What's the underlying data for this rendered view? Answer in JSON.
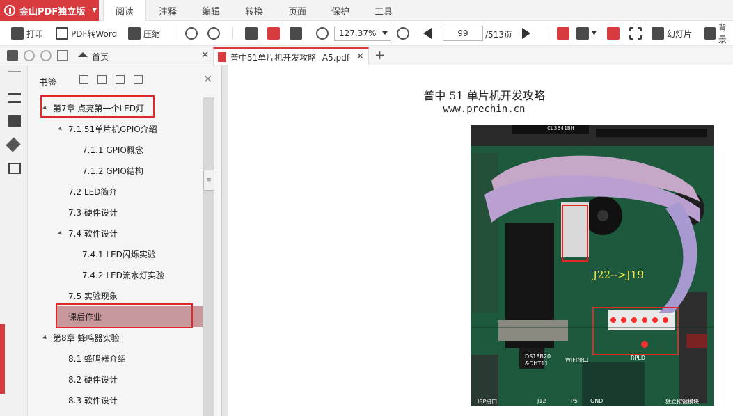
{
  "app": {
    "brand": "金山PDF独立版"
  },
  "menu": {
    "tabs": [
      "阅读",
      "注释",
      "编辑",
      "转换",
      "页面",
      "保护",
      "工具"
    ],
    "active": "阅读"
  },
  "toolbar": {
    "print": "打印",
    "pdf_to_word": "PDF转Word",
    "compress": "压缩",
    "zoom": "127.37%",
    "page_current": "99",
    "page_total": "/513页",
    "slideshow": "幻灯片",
    "background": "背景"
  },
  "tabs": {
    "home": "首页",
    "doc": "普中51单片机开发攻略--A5.pdf"
  },
  "bookmarks": {
    "title": "书签",
    "items": [
      {
        "label": "第7章 点亮第一个LED灯",
        "level": 0,
        "expanded": true
      },
      {
        "label": "7.1 51单片机GPIO介绍",
        "level": 1,
        "expanded": true
      },
      {
        "label": "7.1.1 GPIO概念",
        "level": 2
      },
      {
        "label": "7.1.2 GPIO结构",
        "level": 2
      },
      {
        "label": "7.2 LED简介",
        "level": 1
      },
      {
        "label": "7.3 硬件设计",
        "level": 1
      },
      {
        "label": "7.4 软件设计",
        "level": 1,
        "expanded": true
      },
      {
        "label": "7.4.1 LED闪烁实验",
        "level": 2
      },
      {
        "label": "7.4.2 LED流水灯实验",
        "level": 2
      },
      {
        "label": "7.5 实验现象",
        "level": 1
      },
      {
        "label": "课后作业",
        "level": 1,
        "selected": true
      },
      {
        "label": "第8章 蜂鸣器实验",
        "level": 0,
        "expanded": true
      },
      {
        "label": "8.1 蜂鸣器介绍",
        "level": 1
      },
      {
        "label": "8.2 硬件设计",
        "level": 1
      },
      {
        "label": "8.3 软件设计",
        "level": 1
      }
    ]
  },
  "document": {
    "title": "普中 51 单片机开发攻略",
    "url": "www.prechin.cn",
    "photo_label": "J22-->J19",
    "photo_chip_top": "CL3641BH",
    "photo_labels": [
      "DS18B20",
      "&DHT11",
      "WIFI接口",
      "ISP接口",
      "J12",
      "P5",
      "GND",
      "RPLD",
      "独立按键模块"
    ]
  },
  "colors": {
    "accent": "#d83b3e",
    "highlight_box": "#e02828",
    "selected_bg": "#c9989c"
  }
}
